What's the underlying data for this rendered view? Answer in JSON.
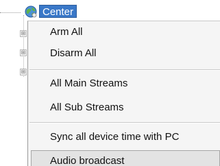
{
  "tree": {
    "root_label": "Center",
    "root_icon": "globe-network-icon",
    "expander_symbol": "⊞",
    "accent_color": "#3a78c8"
  },
  "context_menu": {
    "items": [
      {
        "label": "Arm All"
      },
      {
        "label": "Disarm All"
      },
      {
        "label": "All Main Streams"
      },
      {
        "label": "All Sub Streams"
      },
      {
        "label": "Sync all device time with PC"
      },
      {
        "label": "Audio broadcast",
        "highlighted": true
      }
    ]
  }
}
